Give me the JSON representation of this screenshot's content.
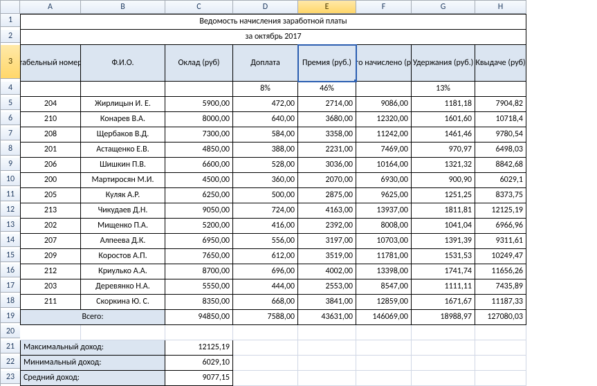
{
  "columns": [
    "A",
    "B",
    "C",
    "D",
    "E",
    "F",
    "G",
    "H"
  ],
  "selectedCol": 4,
  "rowCount": 23,
  "title1": "Ведомость начисления заработной платы",
  "title2": "за октябрь 2017",
  "headers": {
    "A": "табельный номер",
    "B": "Ф.И.О.",
    "C": "Оклад (руб)",
    "D": "Доплата",
    "E": "Премия (руб.)",
    "F": "Всего начислено (руб.)",
    "G": "Удержания (руб.)",
    "H": "Квыдаче (руб)"
  },
  "percents": {
    "D": "8%",
    "E": "46%",
    "G": "13%"
  },
  "rows": [
    {
      "n": "204",
      "fio": "Жирлицын И. Е.",
      "c": "5900,00",
      "d": "472,00",
      "e": "2714,00",
      "f": "9086,00",
      "g": "1181,18",
      "h": "7904,82"
    },
    {
      "n": "210",
      "fio": "Конарев В.А.",
      "c": "8000,00",
      "d": "640,00",
      "e": "3680,00",
      "f": "12320,00",
      "g": "1601,60",
      "h": "10718,4"
    },
    {
      "n": "208",
      "fio": "Щербаков В.Д.",
      "c": "7300,00",
      "d": "584,00",
      "e": "3358,00",
      "f": "11242,00",
      "g": "1461,46",
      "h": "9780,54"
    },
    {
      "n": "201",
      "fio": "Астащенко Е.В.",
      "c": "4850,00",
      "d": "388,00",
      "e": "2231,00",
      "f": "7469,00",
      "g": "970,97",
      "h": "6498,03"
    },
    {
      "n": "206",
      "fio": "Шишкин П.В.",
      "c": "6600,00",
      "d": "528,00",
      "e": "3036,00",
      "f": "10164,00",
      "g": "1321,32",
      "h": "8842,68"
    },
    {
      "n": "200",
      "fio": "Мартиросян М.И.",
      "c": "4500,00",
      "d": "360,00",
      "e": "2070,00",
      "f": "6930,00",
      "g": "900,90",
      "h": "6029,1"
    },
    {
      "n": "205",
      "fio": "Куляк А.Р.",
      "c": "6250,00",
      "d": "500,00",
      "e": "2875,00",
      "f": "9625,00",
      "g": "1251,25",
      "h": "8373,75"
    },
    {
      "n": "213",
      "fio": "Чикудаев Д.Н.",
      "c": "9050,00",
      "d": "724,00",
      "e": "4163,00",
      "f": "13937,00",
      "g": "1811,81",
      "h": "12125,19"
    },
    {
      "n": "202",
      "fio": "Мищенко П.А.",
      "c": "5200,00",
      "d": "416,00",
      "e": "2392,00",
      "f": "8008,00",
      "g": "1041,04",
      "h": "6966,96"
    },
    {
      "n": "207",
      "fio": "Алпеева Д.К.",
      "c": "6950,00",
      "d": "556,00",
      "e": "3197,00",
      "f": "10703,00",
      "g": "1391,39",
      "h": "9311,61"
    },
    {
      "n": "209",
      "fio": "Коростов А.П.",
      "c": "7650,00",
      "d": "612,00",
      "e": "3519,00",
      "f": "11781,00",
      "g": "1531,53",
      "h": "10249,47"
    },
    {
      "n": "212",
      "fio": "Криулько А.А.",
      "c": "8700,00",
      "d": "696,00",
      "e": "4002,00",
      "f": "13398,00",
      "g": "1741,74",
      "h": "11656,26"
    },
    {
      "n": "203",
      "fio": "Деревянко Н.А.",
      "c": "5550,00",
      "d": "444,00",
      "e": "2553,00",
      "f": "8547,00",
      "g": "1111,11",
      "h": "7435,89"
    },
    {
      "n": "211",
      "fio": "Скоркина Ю. С.",
      "c": "8350,00",
      "d": "668,00",
      "e": "3841,00",
      "f": "12859,00",
      "g": "1671,67",
      "h": "11187,33"
    }
  ],
  "totals": {
    "label": "Всего:",
    "c": "94850,00",
    "d": "7588,00",
    "e": "43631,00",
    "f": "146069,00",
    "g": "18988,97",
    "h": "127080,03"
  },
  "summary": [
    {
      "label": "Максимальный доход:",
      "val": "12125,19"
    },
    {
      "label": "Минимальный доход:",
      "val": "6029,10"
    },
    {
      "label": "Средний доход:",
      "val": "9077,15"
    }
  ]
}
